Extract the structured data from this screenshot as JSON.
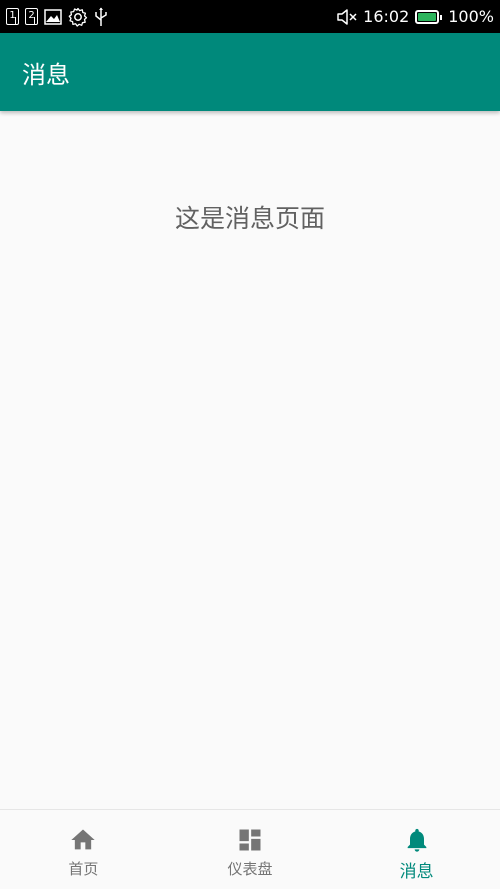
{
  "status_bar": {
    "sim1": "1",
    "sim2": "2",
    "time": "16:02",
    "battery": "100%",
    "battery_level": 1.0,
    "icons": [
      "sim1-icon",
      "sim2-icon",
      "image-icon",
      "gear-icon",
      "usb-icon",
      "mute-icon",
      "battery-icon"
    ]
  },
  "app_bar": {
    "title": "消息",
    "color": "#00897b"
  },
  "content": {
    "text": "这是消息页面"
  },
  "bottom_nav": {
    "active_color": "#00897b",
    "inactive_color": "#757575",
    "items": [
      {
        "label": "首页",
        "icon": "home-icon",
        "active": false
      },
      {
        "label": "仪表盘",
        "icon": "dashboard-icon",
        "active": false
      },
      {
        "label": "消息",
        "icon": "bell-icon",
        "active": true
      }
    ]
  }
}
